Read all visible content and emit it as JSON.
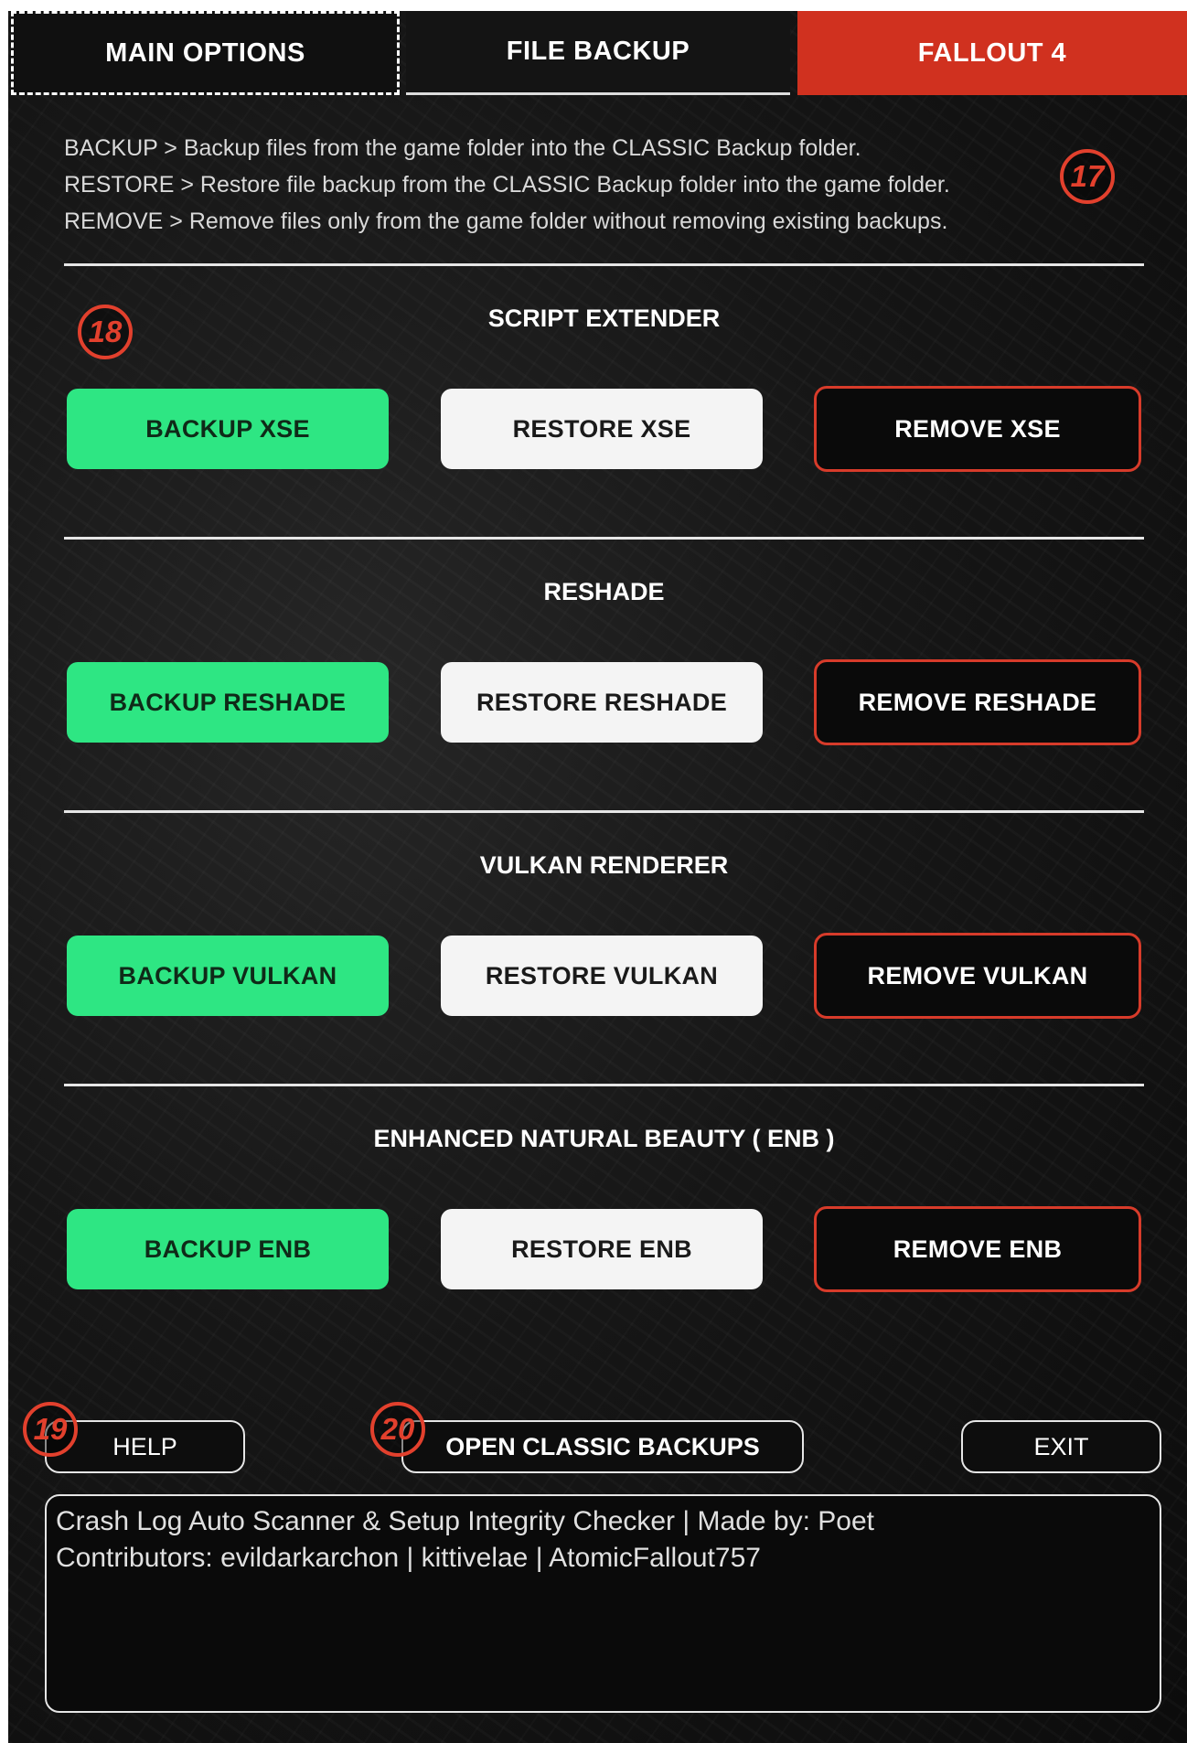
{
  "tabs": {
    "main": "MAIN OPTIONS",
    "file": "FILE BACKUP",
    "game": "FALLOUT 4"
  },
  "info": {
    "backup": "BACKUP > Backup files from the game folder into the CLASSIC Backup folder.",
    "restore": "RESTORE > Restore file backup from the CLASSIC Backup folder into the game folder.",
    "remove": "REMOVE > Remove files only from the game folder without removing existing backups."
  },
  "sections": [
    {
      "title": "SCRIPT EXTENDER",
      "backup": "BACKUP XSE",
      "restore": "RESTORE XSE",
      "remove": "REMOVE XSE"
    },
    {
      "title": "RESHADE",
      "backup": "BACKUP RESHADE",
      "restore": "RESTORE RESHADE",
      "remove": "REMOVE RESHADE"
    },
    {
      "title": "VULKAN RENDERER",
      "backup": "BACKUP VULKAN",
      "restore": "RESTORE VULKAN",
      "remove": "REMOVE VULKAN"
    },
    {
      "title": "ENHANCED NATURAL BEAUTY ( ENB )",
      "backup": "BACKUP ENB",
      "restore": "RESTORE ENB",
      "remove": "REMOVE ENB"
    }
  ],
  "bottom": {
    "help": "HELP",
    "open_backups": "OPEN CLASSIC BACKUPS",
    "exit": "EXIT"
  },
  "log": {
    "line1": "Crash Log Auto Scanner & Setup Integrity Checker | Made by: Poet",
    "line2": "Contributors: evildarkarchon | kittivelae | AtomicFallout757"
  },
  "markers": [
    "17",
    "18",
    "19",
    "20"
  ],
  "colors": {
    "accent_red": "#d0311f",
    "backup_green": "#2ee683",
    "restore_white": "#f4f4f4",
    "remove_border": "#d73b2a"
  }
}
